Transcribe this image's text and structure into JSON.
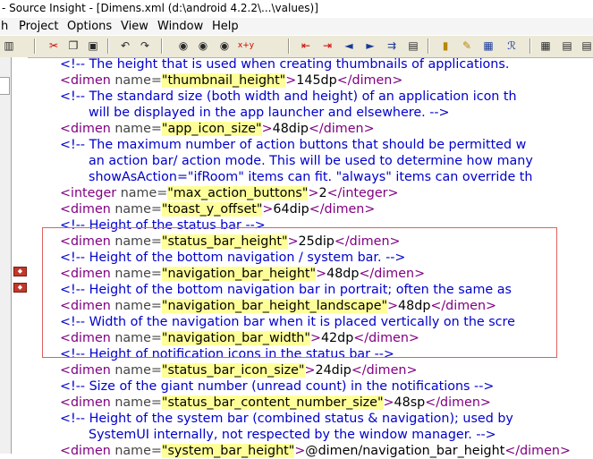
{
  "window": {
    "title": "- Source Insight - [Dimens.xml (d:\\android 4.2.2\\...\\values)]"
  },
  "menu": [
    {
      "label": "h"
    },
    {
      "label": "Project"
    },
    {
      "label": "Options"
    },
    {
      "label": "View"
    },
    {
      "label": "Window"
    },
    {
      "label": "Help"
    }
  ],
  "toolbar": {
    "icons": [
      "save-icon",
      "cut-icon",
      "copy-icon",
      "paste-icon",
      "undo-icon",
      "redo-icon",
      "find-icon",
      "find-next-icon",
      "find-prev-icon",
      "replace-icon",
      "jump-back-icon",
      "jump-forward-icon",
      "arrow-left-icon",
      "arrow-right-icon",
      "arrow-jump-icon",
      "window-icon",
      "lock-icon",
      "highlight-icon",
      "book-icon",
      "relation-icon",
      "symbol-icon",
      "layout-icon",
      "list-icon",
      "browse-icon"
    ],
    "replace_text": "x+y"
  },
  "editor": {
    "lines": [
      {
        "parts": [
          {
            "k": "c",
            "s": "<!-- The height that is used when creating thumbnails of applications."
          }
        ]
      },
      {
        "parts": [
          {
            "k": "t",
            "s": "<dimen "
          },
          {
            "k": "a",
            "s": "name="
          },
          {
            "k": "v",
            "s": "\"thumbnail_height\""
          },
          {
            "k": "t",
            "s": ">"
          },
          {
            "k": "x",
            "s": "145dp"
          },
          {
            "k": "t",
            "s": "</dimen>"
          }
        ]
      },
      {
        "parts": [
          {
            "k": "c",
            "s": "<!-- The standard size (both width and height) of an application icon th"
          }
        ]
      },
      {
        "indent": true,
        "parts": [
          {
            "k": "c",
            "s": "will be displayed in the app launcher and elsewhere. -->"
          }
        ]
      },
      {
        "parts": [
          {
            "k": "t",
            "s": "<dimen "
          },
          {
            "k": "a",
            "s": "name="
          },
          {
            "k": "v",
            "s": "\"app_icon_size\""
          },
          {
            "k": "t",
            "s": ">"
          },
          {
            "k": "x",
            "s": "48dip"
          },
          {
            "k": "t",
            "s": "</dimen>"
          }
        ]
      },
      {
        "parts": [
          {
            "k": "c",
            "s": "<!-- The maximum number of action buttons that should be permitted w"
          }
        ]
      },
      {
        "indent": true,
        "parts": [
          {
            "k": "c",
            "s": "an action bar/ action mode. This will be used to determine how many"
          }
        ]
      },
      {
        "indent": true,
        "parts": [
          {
            "k": "c",
            "s": "showAsAction=\"ifRoom\" items can fit. \"always\" items can override th"
          }
        ]
      },
      {
        "parts": [
          {
            "k": "t",
            "s": "<integer "
          },
          {
            "k": "a",
            "s": "name="
          },
          {
            "k": "v",
            "s": "\"max_action_buttons\""
          },
          {
            "k": "t",
            "s": ">"
          },
          {
            "k": "x",
            "s": "2"
          },
          {
            "k": "t",
            "s": "</integer>"
          }
        ]
      },
      {
        "parts": [
          {
            "k": "t",
            "s": "<dimen "
          },
          {
            "k": "a",
            "s": "name="
          },
          {
            "k": "v",
            "s": "\"toast_y_offset\""
          },
          {
            "k": "t",
            "s": ">"
          },
          {
            "k": "x",
            "s": "64dip"
          },
          {
            "k": "t",
            "s": "</dimen>"
          }
        ]
      },
      {
        "parts": [
          {
            "k": "c",
            "s": "<!-- Height of the status bar -->"
          }
        ]
      },
      {
        "parts": [
          {
            "k": "t",
            "s": "<dimen "
          },
          {
            "k": "a",
            "s": "name="
          },
          {
            "k": "v",
            "s": "\"status_bar_height\""
          },
          {
            "k": "t",
            "s": ">"
          },
          {
            "k": "x",
            "s": "25dip"
          },
          {
            "k": "t",
            "s": "</dimen>"
          }
        ]
      },
      {
        "parts": [
          {
            "k": "c",
            "s": "<!-- Height of the bottom navigation / system bar. -->"
          }
        ]
      },
      {
        "parts": [
          {
            "k": "t",
            "s": "<dimen "
          },
          {
            "k": "a",
            "s": "name="
          },
          {
            "k": "v",
            "s": "\"navigation_bar_height\""
          },
          {
            "k": "t",
            "s": ">"
          },
          {
            "k": "x",
            "s": "48dp"
          },
          {
            "k": "t",
            "s": "</dimen>"
          }
        ]
      },
      {
        "parts": [
          {
            "k": "c",
            "s": "<!-- Height of the bottom navigation bar in portrait; often the same as"
          }
        ]
      },
      {
        "parts": [
          {
            "k": "t",
            "s": "<dimen "
          },
          {
            "k": "a",
            "s": "name="
          },
          {
            "k": "v",
            "s": "\"navigation_bar_height_landscape\""
          },
          {
            "k": "t",
            "s": ">"
          },
          {
            "k": "x",
            "s": "48dp"
          },
          {
            "k": "t",
            "s": "</dimen>"
          }
        ]
      },
      {
        "parts": [
          {
            "k": "c",
            "s": "<!-- Width of the navigation bar when it is placed vertically on the scre"
          }
        ]
      },
      {
        "parts": [
          {
            "k": "t",
            "s": "<dimen "
          },
          {
            "k": "a",
            "s": "name="
          },
          {
            "k": "v",
            "s": "\"navigation_bar_width\""
          },
          {
            "k": "t",
            "s": ">"
          },
          {
            "k": "x",
            "s": "42dp"
          },
          {
            "k": "t",
            "s": "</dimen>"
          }
        ]
      },
      {
        "parts": [
          {
            "k": "c",
            "s": "<!-- Height of notification icons in the status bar -->"
          }
        ]
      },
      {
        "parts": [
          {
            "k": "t",
            "s": "<dimen "
          },
          {
            "k": "a",
            "s": "name="
          },
          {
            "k": "v",
            "s": "\"status_bar_icon_size\""
          },
          {
            "k": "t",
            "s": ">"
          },
          {
            "k": "x",
            "s": "24dip"
          },
          {
            "k": "t",
            "s": "</dimen>"
          }
        ]
      },
      {
        "parts": [
          {
            "k": "c",
            "s": "<!-- Size of the giant number (unread count) in the notifications -->"
          }
        ]
      },
      {
        "parts": [
          {
            "k": "t",
            "s": "<dimen "
          },
          {
            "k": "a",
            "s": "name="
          },
          {
            "k": "v",
            "s": "\"status_bar_content_number_size\""
          },
          {
            "k": "t",
            "s": ">"
          },
          {
            "k": "x",
            "s": "48sp"
          },
          {
            "k": "t",
            "s": "</dimen>"
          }
        ]
      },
      {
        "parts": [
          {
            "k": "c",
            "s": "<!-- Height of the system bar (combined status & navigation); used by"
          }
        ]
      },
      {
        "indent": true,
        "parts": [
          {
            "k": "c",
            "s": "SystemUI internally, not respected by the window manager. -->"
          }
        ]
      },
      {
        "parts": [
          {
            "k": "t",
            "s": "<dimen "
          },
          {
            "k": "a",
            "s": "name="
          },
          {
            "k": "v",
            "s": "\"system_bar_height\""
          },
          {
            "k": "t",
            "s": ">"
          },
          {
            "k": "x",
            "s": "@dimen/navigation_bar_height"
          },
          {
            "k": "t",
            "s": "</dimen>"
          }
        ]
      }
    ],
    "bookmarks": [
      {
        "line": 13,
        "glyph": "◆"
      },
      {
        "line": 14,
        "glyph": "◆"
      }
    ]
  }
}
